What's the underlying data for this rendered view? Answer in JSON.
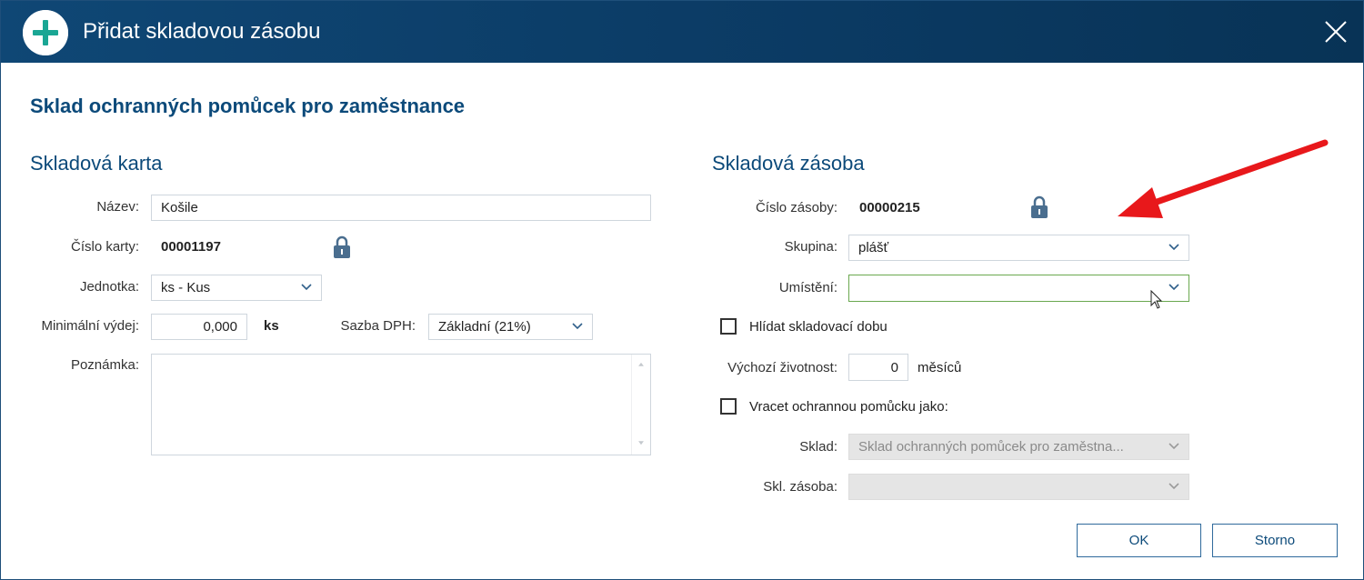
{
  "window": {
    "title": "Přidat skladovou zásobu"
  },
  "page_heading": "Sklad ochranných pomůcek pro zaměstnance",
  "left": {
    "section_title": "Skladová karta",
    "name_label": "Název:",
    "name_value": "Košile",
    "card_no_label": "Číslo karty:",
    "card_no_value": "00001197",
    "unit_label": "Jednotka:",
    "unit_value": "ks - Kus",
    "min_label": "Minimální výdej:",
    "min_value": "0,000",
    "min_unit": "ks",
    "vat_label": "Sazba DPH:",
    "vat_value": "Základní (21%)",
    "note_label": "Poznámka:"
  },
  "right": {
    "section_title": "Skladová zásoba",
    "stock_no_label": "Číslo zásoby:",
    "stock_no_value": "00000215",
    "group_label": "Skupina:",
    "group_value": "plášť",
    "location_label": "Umístění:",
    "location_value": "",
    "watch_label": "Hlídat skladovací dobu",
    "lifetime_label": "Výchozí životnost:",
    "lifetime_value": "0",
    "lifetime_unit": "měsíců",
    "return_label": "Vracet ochrannou pomůcku jako:",
    "warehouse_label": "Sklad:",
    "warehouse_value": "Sklad ochranných pomůcek pro zaměstna...",
    "stock_label": "Skl. zásoba:",
    "stock_value": ""
  },
  "buttons": {
    "ok": "OK",
    "cancel": "Storno"
  },
  "colors": {
    "titlebar": "#0b3a63",
    "accent": "#0c4a7a",
    "plus_icon": "#1aa694",
    "annotation_arrow": "#e8181b"
  }
}
